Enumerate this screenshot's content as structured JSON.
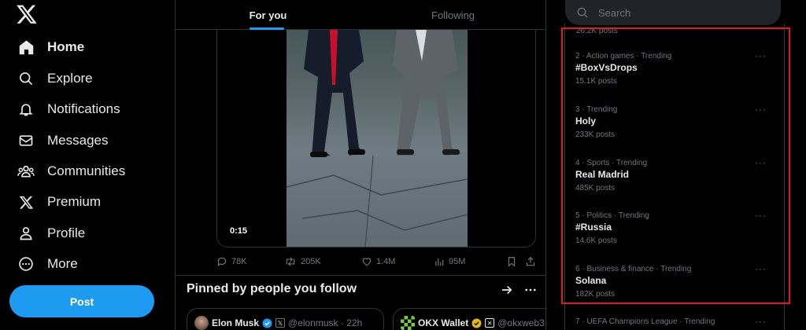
{
  "nav": {
    "items": [
      {
        "label": "Home",
        "icon": "home-icon",
        "active": true
      },
      {
        "label": "Explore",
        "icon": "search-icon"
      },
      {
        "label": "Notifications",
        "icon": "bell-icon"
      },
      {
        "label": "Messages",
        "icon": "mail-icon"
      },
      {
        "label": "Communities",
        "icon": "people-icon"
      },
      {
        "label": "Premium",
        "icon": "x-logo-icon"
      },
      {
        "label": "Profile",
        "icon": "person-icon"
      },
      {
        "label": "More",
        "icon": "more-circle-icon"
      }
    ],
    "post_label": "Post"
  },
  "tabs": [
    {
      "label": "For you",
      "active": true
    },
    {
      "label": "Following",
      "active": false
    }
  ],
  "media": {
    "timestamp": "0:15"
  },
  "actions": {
    "replies": "78K",
    "reposts": "205K",
    "likes": "1.4M",
    "views": "95M"
  },
  "pinned": {
    "title": "Pinned by people you follow",
    "cards": [
      {
        "name": "Elon Musk",
        "handle": "@elonmusk · 22h"
      },
      {
        "name": "OKX Wallet",
        "handle": "@okxweb3"
      }
    ]
  },
  "search": {
    "placeholder": "Search"
  },
  "trends": {
    "previous_count": "26.2K posts",
    "items": [
      {
        "context": "2 · Action games · Trending",
        "title": "#BoxVsDrops",
        "count": "15.1K posts"
      },
      {
        "context": "3 · Trending",
        "title": "Holy",
        "count": "233K posts"
      },
      {
        "context": "4 · Sports · Trending",
        "title": "Real Madrid",
        "count": "485K posts"
      },
      {
        "context": "5 · Politics · Trending",
        "title": "#Russia",
        "count": "14.6K posts"
      },
      {
        "context": "6 · Business & finance · Trending",
        "title": "Solana",
        "count": "182K posts"
      },
      {
        "context": "7 · UEFA Champions League · Trending",
        "title": "",
        "count": ""
      }
    ],
    "more_glyph": "···"
  },
  "colors": {
    "accent": "#1d9bf0",
    "border": "#2f3336",
    "muted": "#71767b",
    "highlight": "#e01b1b"
  }
}
